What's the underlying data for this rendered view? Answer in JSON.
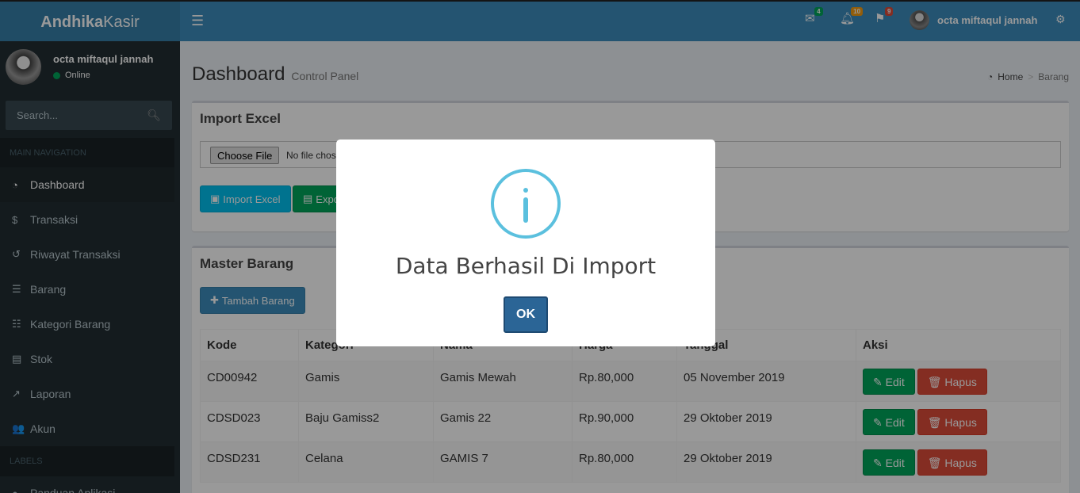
{
  "brand": {
    "bold": "Andhika",
    "light": "Kasir"
  },
  "navbar": {
    "toggle_icon": "hamburger-icon",
    "notifications": [
      {
        "icon": "envelope-icon",
        "badge": "4",
        "color": "#00a65a"
      },
      {
        "icon": "bell-icon",
        "badge": "10",
        "color": "#f39c12"
      },
      {
        "icon": "flag-icon",
        "badge": "9",
        "color": "#dd4b39"
      }
    ],
    "user_name": "octa miftaqul jannah",
    "settings_icon": "gears-icon"
  },
  "sidebar": {
    "user_name": "octa miftaqul jannah",
    "status": "Online",
    "search_placeholder": "Search...",
    "main_header": "MAIN NAVIGATION",
    "items": [
      {
        "label": "Dashboard",
        "icon": "tachometer-icon",
        "glyph": "◔"
      },
      {
        "label": "Transaksi",
        "icon": "dollar-icon",
        "glyph": "$"
      },
      {
        "label": "Riwayat Transaksi",
        "icon": "history-icon",
        "glyph": "↺"
      },
      {
        "label": "Barang",
        "icon": "database-icon",
        "glyph": "☰"
      },
      {
        "label": "Kategori Barang",
        "icon": "list-icon",
        "glyph": "☷"
      },
      {
        "label": "Stok",
        "icon": "book-icon",
        "glyph": "▤"
      },
      {
        "label": "Laporan",
        "icon": "line-chart-icon",
        "glyph": "↗"
      },
      {
        "label": "Akun",
        "icon": "users-icon",
        "glyph": "👥"
      }
    ],
    "labels_header": "LABELS",
    "label_items": [
      {
        "label": "Panduan Aplikasi",
        "icon": "info-circle-icon",
        "glyph": "●"
      }
    ]
  },
  "header": {
    "title": "Dashboard",
    "subtitle": "Control Panel",
    "breadcrumb": {
      "home": "Home",
      "current": "Barang"
    }
  },
  "import_box": {
    "title": "Import Excel",
    "file_button": "Choose File",
    "file_text": "No file chosen",
    "import_label": "Import Excel",
    "export_label": "Export Excel"
  },
  "master_box": {
    "title": "Master Barang",
    "add_label": "Tambah Barang",
    "columns": [
      "Kode",
      "Kategori",
      "Nama",
      "Harga",
      "Tanggal",
      "Aksi"
    ],
    "rows": [
      {
        "kode": "CD00942",
        "kategori": "Gamis",
        "nama": "Gamis Mewah",
        "harga": "Rp.80,000",
        "tanggal": "05 November 2019"
      },
      {
        "kode": "CDSD023",
        "kategori": "Baju Gamiss2",
        "nama": "Gamis 22",
        "harga": "Rp.90,000",
        "tanggal": "29 Oktober 2019"
      },
      {
        "kode": "CDSD231",
        "kategori": "Celana",
        "nama": "GAMIS 7",
        "harga": "Rp.80,000",
        "tanggal": "29 Oktober 2019"
      }
    ],
    "edit_label": "Edit",
    "delete_label": "Hapus"
  },
  "modal": {
    "icon": "info-icon",
    "message": "Data Berhasil Di Import",
    "ok_label": "OK"
  }
}
